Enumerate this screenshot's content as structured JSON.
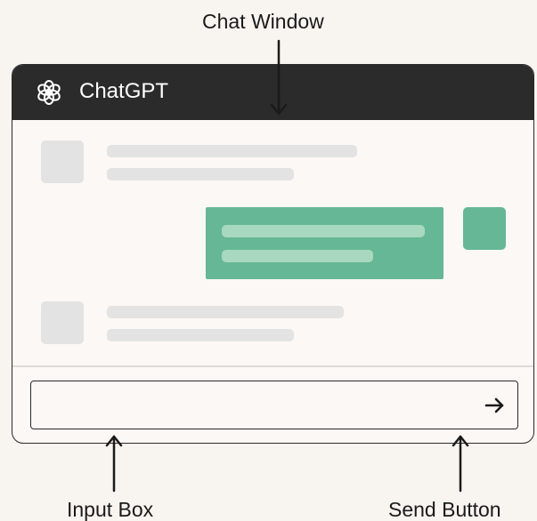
{
  "callouts": {
    "chat_window": "Chat Window",
    "input_box": "Input Box",
    "send_button": "Send Button"
  },
  "window": {
    "title": "ChatGPT",
    "logo_icon": "openai-logo-icon",
    "send_icon": "arrow-right-icon"
  },
  "messages": [
    {
      "role": "assistant",
      "placeholder_lines": 2
    },
    {
      "role": "user",
      "placeholder_lines": 2
    },
    {
      "role": "assistant",
      "placeholder_lines": 2
    }
  ],
  "colors": {
    "titlebar": "#2b2b2b",
    "user_bubble": "#66b796",
    "placeholder": "#e3e3e3",
    "background": "#f8f5f1"
  }
}
